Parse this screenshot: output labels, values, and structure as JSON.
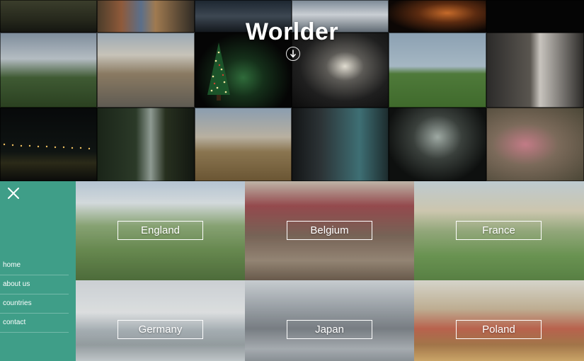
{
  "brand": {
    "title": "Worlder"
  },
  "icons": {
    "scroll": "arrow-down-icon",
    "close": "close-icon"
  },
  "colors": {
    "menu_bg": "#3f9e88",
    "text": "#ffffff"
  },
  "menu": {
    "items": [
      {
        "label": "home"
      },
      {
        "label": "about us"
      },
      {
        "label": "countries"
      },
      {
        "label": "contact"
      }
    ]
  },
  "countries": [
    {
      "name": "England"
    },
    {
      "name": "Belgium"
    },
    {
      "name": "France"
    },
    {
      "name": "Germany"
    },
    {
      "name": "Japan"
    },
    {
      "name": "Poland"
    }
  ]
}
